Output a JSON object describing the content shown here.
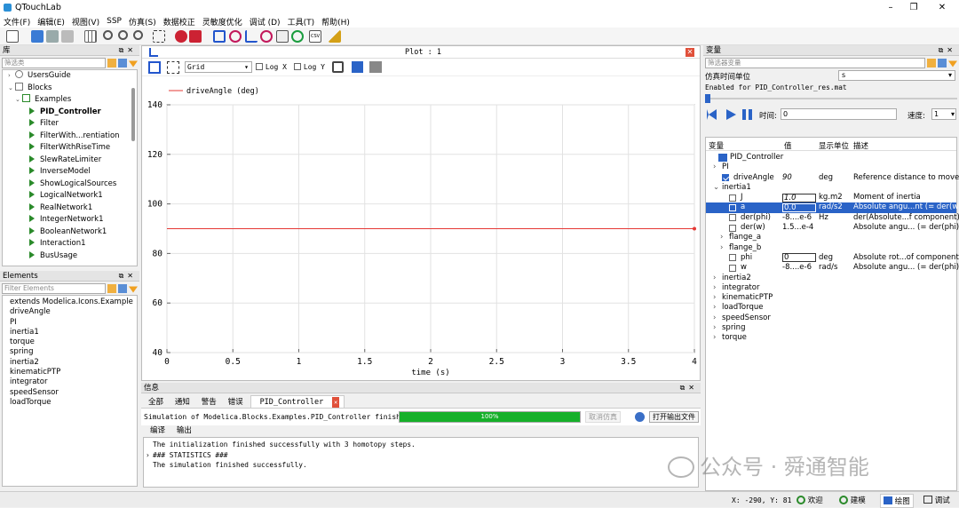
{
  "app": {
    "title": "QTouchLab"
  },
  "menu": [
    "文件(F)",
    "编辑(E)",
    "视图(V)",
    "SSP",
    "仿真(S)",
    "数据校正",
    "灵敏度优化",
    "调试 (D)",
    "工具(T)",
    "帮助(H)"
  ],
  "library": {
    "title": "库",
    "filter_placeholder": "筛选类",
    "items": [
      {
        "label": "UsersGuide",
        "level": 1,
        "exp": "right"
      },
      {
        "label": "Blocks",
        "level": 1,
        "exp": "down"
      },
      {
        "label": "Examples",
        "level": 2,
        "exp": "down"
      },
      {
        "label": "PID_Controller",
        "level": 3,
        "bold": true
      },
      {
        "label": "Filter",
        "level": 3
      },
      {
        "label": "FilterWith...rentiation",
        "level": 3
      },
      {
        "label": "FilterWithRiseTime",
        "level": 3
      },
      {
        "label": "SlewRateLimiter",
        "level": 3
      },
      {
        "label": "InverseModel",
        "level": 3
      },
      {
        "label": "ShowLogicalSources",
        "level": 3
      },
      {
        "label": "LogicalNetwork1",
        "level": 3
      },
      {
        "label": "RealNetwork1",
        "level": 3
      },
      {
        "label": "IntegerNetwork1",
        "level": 3
      },
      {
        "label": "BooleanNetwork1",
        "level": 3
      },
      {
        "label": "Interaction1",
        "level": 3
      },
      {
        "label": "BusUsage",
        "level": 3
      }
    ]
  },
  "elements": {
    "title": "Elements",
    "filter_placeholder": "Filter Elements",
    "items": [
      "extends Modelica.Icons.Example",
      "driveAngle",
      "PI",
      "inertia1",
      "torque",
      "spring",
      "inertia2",
      "kinematicPTP",
      "integrator",
      "speedSensor",
      "loadTorque"
    ]
  },
  "plot": {
    "title": "Plot : 1",
    "grid_select": "Grid",
    "logx": "Log X",
    "logy": "Log Y"
  },
  "chart_data": {
    "type": "line",
    "legend_position": "top-left",
    "series": [
      {
        "name": "driveAngle (deg)",
        "x": [
          0,
          4
        ],
        "y": [
          90,
          90
        ],
        "color": "#e53935"
      }
    ],
    "xlabel": "time (s)",
    "xlim": [
      0,
      4
    ],
    "ylim": [
      40,
      140
    ],
    "xticks": [
      "0",
      "0.5",
      "1",
      "1.5",
      "2",
      "2.5",
      "3",
      "3.5",
      "4"
    ],
    "yticks": [
      "40",
      "60",
      "80",
      "100",
      "120",
      "140"
    ],
    "grid": true
  },
  "messages": {
    "title": "信息",
    "tabs": [
      "全部",
      "通知",
      "警告",
      "错误",
      "PID_Controller"
    ],
    "sim_text": "Simulation of Modelica.Blocks.Examples.PID_Controller finished.",
    "progress_label": "100%",
    "progress": 1.0,
    "cancel": "取消仿真",
    "open_output": "打开输出文件",
    "subtabs": [
      "编译",
      "输出"
    ],
    "log": [
      "The initialization finished successfully with 3 homotopy steps.",
      "### STATISTICS ###",
      "The simulation finished successfully."
    ]
  },
  "variables": {
    "title": "变量",
    "filter_placeholder": "筛选器变量",
    "time_unit_label": "仿真时间单位",
    "time_unit": "s",
    "enabled_text": "Enabled for PID_Controller_res.mat",
    "time_label": "时间:",
    "time_value": "0",
    "speed_label": "速度:",
    "speed_value": "1",
    "headers": [
      "变量",
      "值",
      "显示单位",
      "描述"
    ],
    "rows": [
      {
        "name": "PID_Controller",
        "lvl": 0,
        "type": "model"
      },
      {
        "name": "PI",
        "lvl": 1,
        "type": "group",
        "exp": "right"
      },
      {
        "name": "driveAngle",
        "lvl": 2,
        "type": "var",
        "checked": true,
        "value": "90",
        "unit": "deg",
        "desc": "Reference distance to move",
        "italic": true
      },
      {
        "name": "inertia1",
        "lvl": 1,
        "type": "group",
        "exp": "down"
      },
      {
        "name": "J",
        "lvl": 3,
        "type": "var",
        "value": "1.0",
        "unit": "kg.m2",
        "desc": "Moment of inertia",
        "boxed": true,
        "italic": true
      },
      {
        "name": "a",
        "lvl": 3,
        "type": "var",
        "value": "0.0",
        "unit": "rad/s2",
        "desc": "Absolute angu...nt (= der(w))",
        "selected": true
      },
      {
        "name": "der(phi)",
        "lvl": 3,
        "type": "var",
        "value": "-8....e-6",
        "unit": "Hz",
        "desc": "der(Absolute...f component)"
      },
      {
        "name": "der(w)",
        "lvl": 3,
        "type": "var",
        "value": "1.5...e-4",
        "unit": "",
        "desc": "Absolute angu... (= der(phi))"
      },
      {
        "name": "flange_a",
        "lvl": 2,
        "type": "group",
        "exp": "right"
      },
      {
        "name": "flange_b",
        "lvl": 2,
        "type": "group",
        "exp": "right"
      },
      {
        "name": "phi",
        "lvl": 3,
        "type": "var",
        "value": "0",
        "unit": "deg",
        "desc": "Absolute rot...of component",
        "boxed": true
      },
      {
        "name": "w",
        "lvl": 3,
        "type": "var",
        "value": "-8....e-6",
        "unit": "rad/s",
        "desc": "Absolute angu... (= der(phi))"
      },
      {
        "name": "inertia2",
        "lvl": 1,
        "type": "group",
        "exp": "right"
      },
      {
        "name": "integrator",
        "lvl": 1,
        "type": "group",
        "exp": "right"
      },
      {
        "name": "kinematicPTP",
        "lvl": 1,
        "type": "group",
        "exp": "right"
      },
      {
        "name": "loadTorque",
        "lvl": 1,
        "type": "group",
        "exp": "right"
      },
      {
        "name": "speedSensor",
        "lvl": 1,
        "type": "group",
        "exp": "right"
      },
      {
        "name": "spring",
        "lvl": 1,
        "type": "group",
        "exp": "right"
      },
      {
        "name": "torque",
        "lvl": 1,
        "type": "group",
        "exp": "right"
      }
    ]
  },
  "status": {
    "coords": "X: -290, Y: 81",
    "welcome": "欢迎",
    "modeling": "建模",
    "plotting": "绘图",
    "debug": "调试"
  },
  "watermark": "公众号 · 舜通智能"
}
